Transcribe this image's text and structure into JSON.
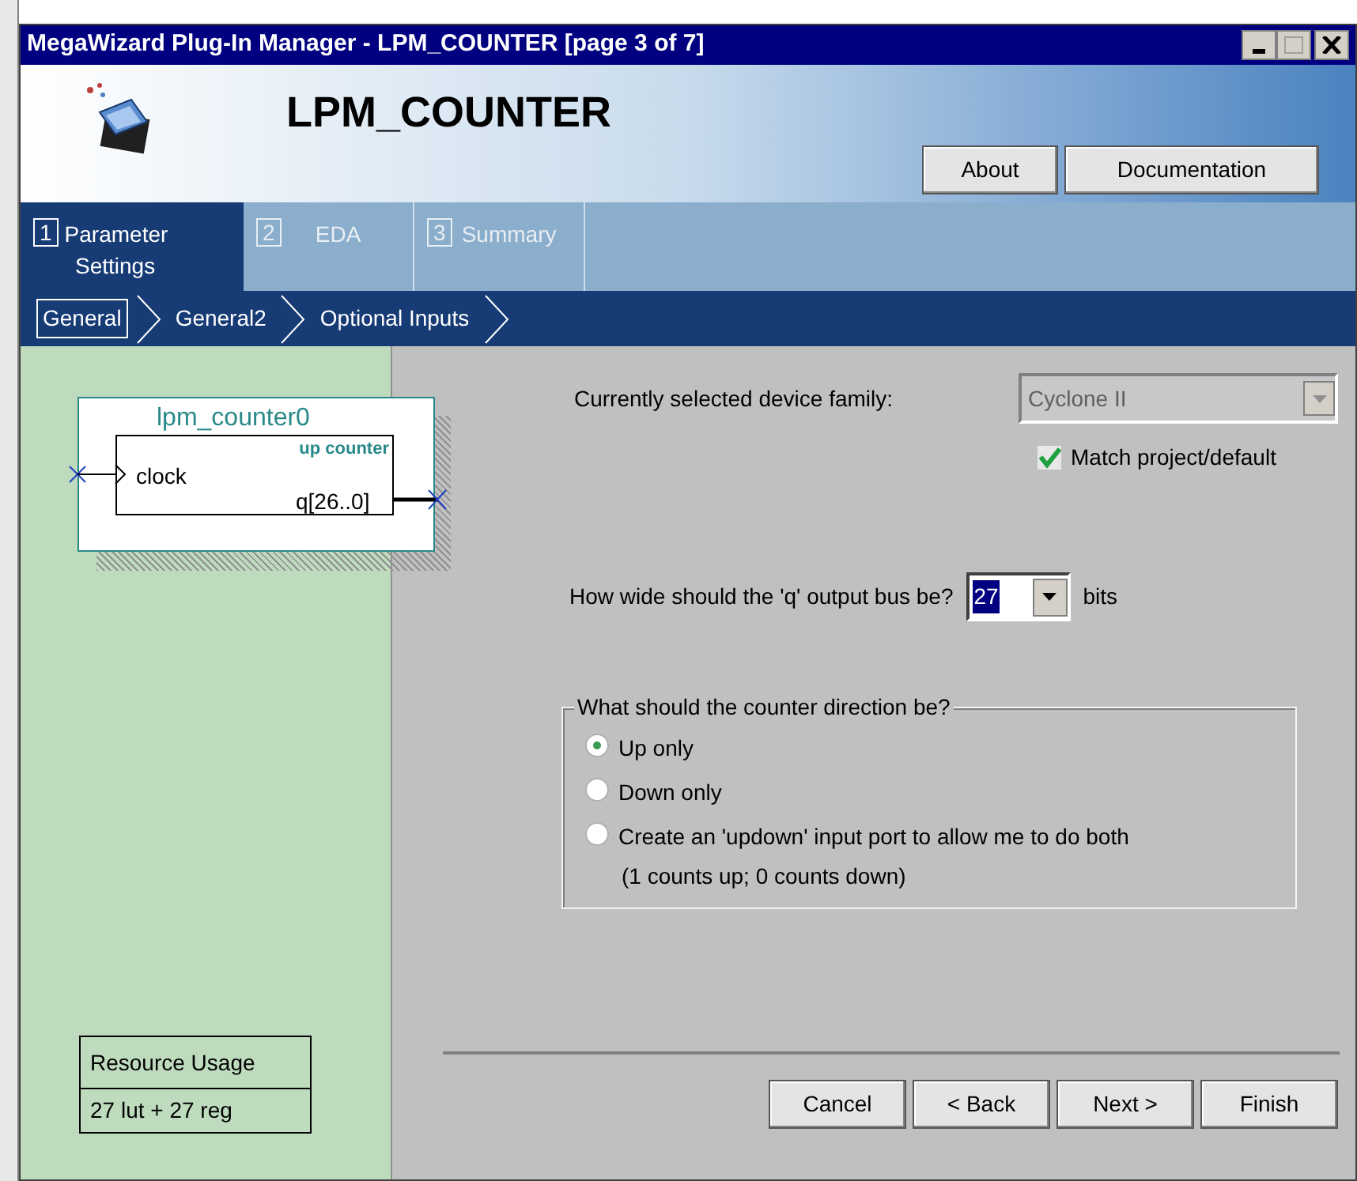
{
  "window": {
    "title": "MegaWizard Plug-In Manager - LPM_COUNTER [page 3 of 7]"
  },
  "header": {
    "title": "LPM_COUNTER",
    "buttons": [
      "About",
      "Documentation"
    ]
  },
  "tabs": [
    {
      "number": "1",
      "label": "Parameter Settings",
      "selected": true
    },
    {
      "number": "2",
      "label": "EDA",
      "selected": false
    },
    {
      "number": "3",
      "label": "Summary",
      "selected": false
    }
  ],
  "steps": [
    {
      "label": "General",
      "selected": true
    },
    {
      "label": "General2",
      "selected": false
    },
    {
      "label": "Optional Inputs",
      "selected": false
    }
  ],
  "symbol": {
    "name": "lpm_counter0",
    "type": "up counter",
    "input": "clock",
    "output": "q[26..0]"
  },
  "resource_usage": {
    "title": "Resource Usage",
    "value": "27 lut + 27 reg"
  },
  "device_family": {
    "label": "Currently selected device family:",
    "value": "Cyclone II",
    "disabled": true
  },
  "match_project": {
    "label": "Match project/default",
    "checked": true
  },
  "bus_width": {
    "label": "How wide should the 'q' output bus be?",
    "value": "27",
    "unit": "bits"
  },
  "direction": {
    "title": "What should the counter direction be?",
    "options": [
      {
        "label": "Up only",
        "selected": true
      },
      {
        "label": "Down only",
        "selected": false
      },
      {
        "label": "Create an 'updown' input port to allow me to do both",
        "note": "(1 counts up; 0 counts down)",
        "selected": false
      }
    ]
  },
  "footer_buttons": [
    "Cancel",
    "< Back",
    "Next >",
    "Finish"
  ]
}
